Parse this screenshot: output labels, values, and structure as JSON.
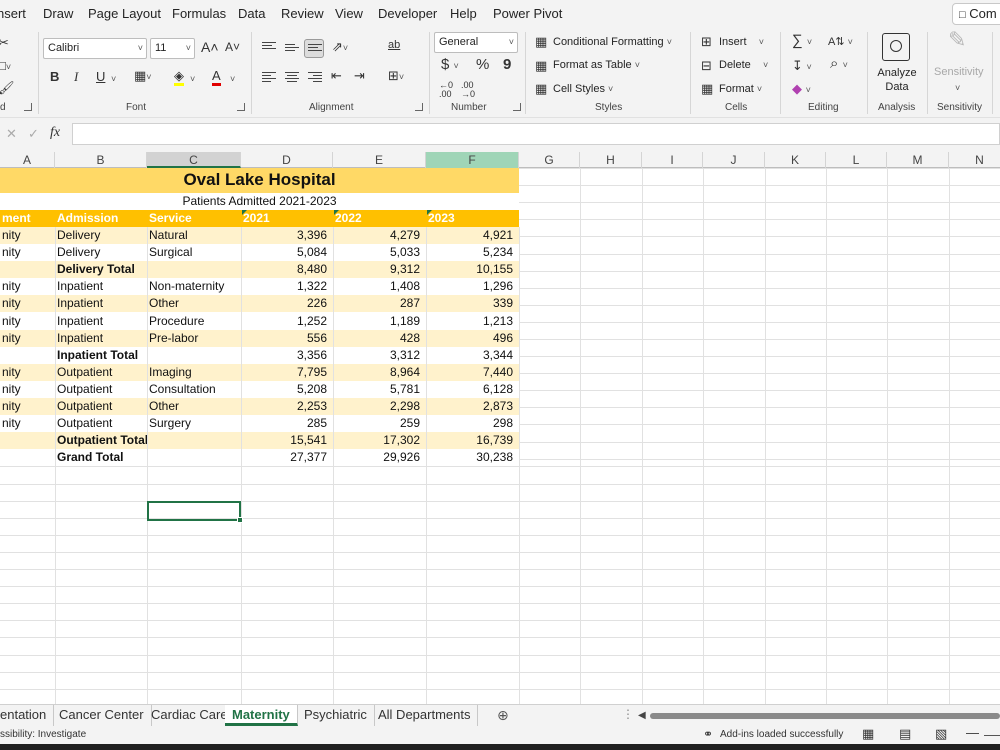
{
  "menu": {
    "items": [
      "nsert",
      "Draw",
      "Page Layout",
      "Formulas",
      "Data",
      "Review",
      "View",
      "Developer",
      "Help",
      "Power Pivot"
    ],
    "comments_label": "Com"
  },
  "ribbon": {
    "groups": {
      "clipboard": "d",
      "font": "Font",
      "alignment": "Alignment",
      "number": "Number",
      "styles": "Styles",
      "cells": "Cells",
      "editing": "Editing",
      "analysis": "Analysis",
      "sensitivity": "Sensitivity"
    },
    "font_name": "Calibri",
    "font_size": "11",
    "number_format": "General",
    "styles": {
      "conditional_formatting": "Conditional Formatting",
      "format_as_table": "Format as Table",
      "cell_styles": "Cell Styles"
    },
    "cells": {
      "insert": "Insert",
      "delete": "Delete",
      "format": "Format"
    },
    "analyze_data": "Analyze Data",
    "sensitivity_btn": "Sensitivity",
    "glyphs": {
      "increase_font": "A˄",
      "decrease_font": "A˅",
      "bold": "B",
      "italic": "I",
      "underline": "U",
      "wrap": "ab",
      "currency": "$",
      "percent": "%",
      "comma": "9",
      "autosum": "∑",
      "sort": "A⇅",
      "find": "⌕"
    }
  },
  "formula_bar": {
    "cancel": "✕",
    "enter": "✓",
    "fx": "fx",
    "content": ""
  },
  "columns": [
    "A",
    "B",
    "C",
    "D",
    "E",
    "F",
    "G",
    "H",
    "I",
    "J",
    "K",
    "L",
    "M",
    "N"
  ],
  "sheet": {
    "title": "Oval Lake Hospital",
    "subtitle": "Patients Admitted 2021-2023",
    "header": [
      "ment",
      "Admission",
      "Service",
      "2021",
      "2022",
      "2023"
    ],
    "rows": [
      {
        "a": "nity",
        "b": "Delivery",
        "c": "Natural",
        "d": "3,396",
        "e": "4,279",
        "f": "4,921",
        "bold": false
      },
      {
        "a": "nity",
        "b": "Delivery",
        "c": "Surgical",
        "d": "5,084",
        "e": "5,033",
        "f": "5,234",
        "bold": false
      },
      {
        "a": "",
        "b": "Delivery Total",
        "c": "",
        "d": "8,480",
        "e": "9,312",
        "f": "10,155",
        "bold": true
      },
      {
        "a": "nity",
        "b": "Inpatient",
        "c": "Non-maternity",
        "d": "1,322",
        "e": "1,408",
        "f": "1,296",
        "bold": false
      },
      {
        "a": "nity",
        "b": "Inpatient",
        "c": "Other",
        "d": "226",
        "e": "287",
        "f": "339",
        "bold": false
      },
      {
        "a": "nity",
        "b": "Inpatient",
        "c": "Procedure",
        "d": "1,252",
        "e": "1,189",
        "f": "1,213",
        "bold": false
      },
      {
        "a": "nity",
        "b": "Inpatient",
        "c": "Pre-labor",
        "d": "556",
        "e": "428",
        "f": "496",
        "bold": false
      },
      {
        "a": "",
        "b": "Inpatient Total",
        "c": "",
        "d": "3,356",
        "e": "3,312",
        "f": "3,344",
        "bold": true
      },
      {
        "a": "nity",
        "b": "Outpatient",
        "c": "Imaging",
        "d": "7,795",
        "e": "8,964",
        "f": "7,440",
        "bold": false
      },
      {
        "a": "nity",
        "b": "Outpatient",
        "c": "Consultation",
        "d": "5,208",
        "e": "5,781",
        "f": "6,128",
        "bold": false
      },
      {
        "a": "nity",
        "b": "Outpatient",
        "c": "Other",
        "d": "2,253",
        "e": "2,298",
        "f": "2,873",
        "bold": false
      },
      {
        "a": "nity",
        "b": "Outpatient",
        "c": "Surgery",
        "d": "285",
        "e": "259",
        "f": "298",
        "bold": false
      },
      {
        "a": "",
        "b": "Outpatient Total",
        "c": "",
        "d": "15,541",
        "e": "17,302",
        "f": "16,739",
        "bold": true
      },
      {
        "a": "",
        "b": "Grand Total",
        "c": "",
        "d": "27,377",
        "e": "29,926",
        "f": "30,238",
        "bold": true
      }
    ]
  },
  "tabs": [
    "entation",
    "Cancer Center",
    "Cardiac Care",
    "Maternity",
    "Psychiatric",
    "All Departments"
  ],
  "active_tab": "Maternity",
  "status": {
    "accessibility": "ssibility: Investigate",
    "addins": "Add-ins loaded successfully"
  },
  "colors": {
    "accent": "#217346",
    "title_fill": "#ffd966",
    "header_fill": "#ffc000",
    "band_fill": "#fff2cc"
  }
}
